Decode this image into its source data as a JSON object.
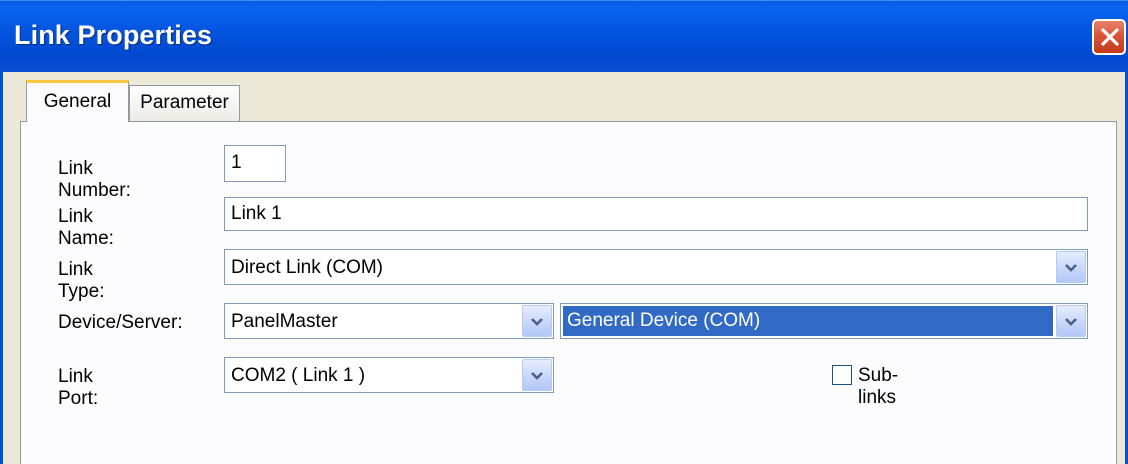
{
  "window": {
    "title": "Link Properties"
  },
  "tabs": [
    {
      "label": "General",
      "active": true
    },
    {
      "label": "Parameter",
      "active": false
    }
  ],
  "form": {
    "link_number": {
      "label": "Link Number:",
      "value": "1"
    },
    "link_name": {
      "label": "Link Name:",
      "value": "Link 1"
    },
    "link_type": {
      "label": "Link Type:",
      "value": "Direct Link (COM)"
    },
    "device_server": {
      "label": "Device/Server:",
      "value": "PanelMaster",
      "device_value": "General Device (COM)"
    },
    "link_port": {
      "label": "Link Port:",
      "value": "COM2 ( Link 1 )"
    },
    "sub_links": {
      "label": "Sub-links",
      "checked": false
    }
  },
  "colors": {
    "title_bar": "#0a52dc",
    "selection": "#316ac5",
    "close_button": "#d9553a",
    "tab_highlight": "#ffc83c"
  }
}
